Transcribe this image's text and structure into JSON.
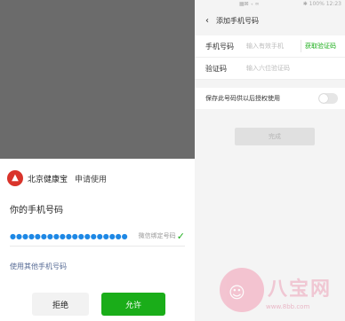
{
  "left": {
    "app_name": "北京健康宝",
    "request_text": "申请使用",
    "sheet_title": "你的手机号码",
    "masked_phone": "●●●●●●●●●●●●●●●●●●●",
    "wechat_bound_tag": "微信绑定号码",
    "other_phone_link": "使用其他手机号码",
    "reject_label": "拒绝",
    "allow_label": "允许",
    "colors": {
      "primary_green": "#1aad19",
      "link_blue": "#576b95",
      "logo_red": "#d9342b"
    }
  },
  "right": {
    "status_left": "▦⊠ ₊ ∞",
    "status_right": "✱ 100% 12:23",
    "nav_title": "添加手机号码",
    "back_icon": "chevron-left-icon",
    "form": {
      "phone_label": "手机号码",
      "phone_placeholder": "输入有效手机",
      "get_code_label": "获取验证码",
      "code_label": "验证码",
      "code_placeholder": "输入六位验证码"
    },
    "save_label": "保存此号码供以后授权使用",
    "save_toggle_on": false,
    "confirm_label": "完成"
  },
  "watermark": {
    "text": "八宝网",
    "url": "www.8bb.com"
  }
}
